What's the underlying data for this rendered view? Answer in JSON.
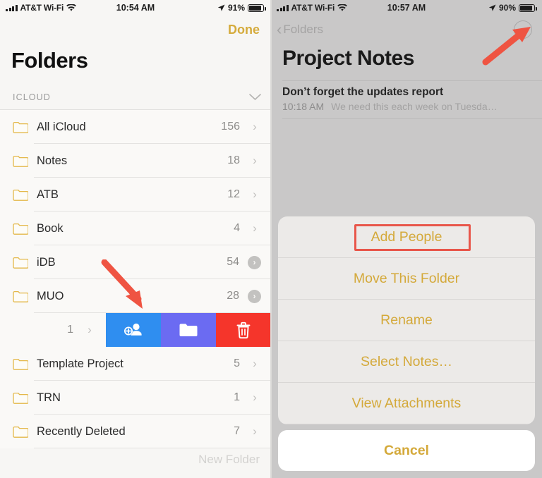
{
  "left_screen": {
    "status_bar": {
      "carrier": "AT&T Wi-Fi",
      "wifi_icon": "wifi-icon",
      "signal_icon": "signal-bars-icon",
      "time": "10:54 AM",
      "location_icon": "location-arrow-icon",
      "battery_percent": "91%",
      "battery_icon": "battery-full-icon"
    },
    "nav": {
      "done_label": "Done"
    },
    "title": "Folders",
    "section": {
      "header": "ICLOUD",
      "collapse_icon": "chevron-down-icon"
    },
    "folders": [
      {
        "name": "All iCloud",
        "count": "156",
        "chevron": "chevron-right-icon",
        "shared": false
      },
      {
        "name": "Notes",
        "count": "18",
        "chevron": "chevron-right-icon",
        "shared": false
      },
      {
        "name": "ATB",
        "count": "12",
        "chevron": "chevron-right-icon",
        "shared": false
      },
      {
        "name": "Book",
        "count": "4",
        "chevron": "chevron-right-icon",
        "shared": false
      },
      {
        "name": "iDB",
        "count": "54",
        "chevron": "chevron-right-circle-icon",
        "shared": true
      },
      {
        "name": "MUO",
        "count": "28",
        "chevron": "chevron-right-circle-icon",
        "shared": true
      }
    ],
    "swiped_row": {
      "count": "1",
      "chevron": "chevron-right-icon",
      "actions": [
        {
          "name": "add-people",
          "icon": "person-add-icon",
          "color": "#2f8ef0"
        },
        {
          "name": "move-folder",
          "icon": "folder-icon",
          "color": "#6b6bf2"
        },
        {
          "name": "delete-folder",
          "icon": "trash-icon",
          "color": "#f5352b"
        }
      ]
    },
    "folders_after": [
      {
        "name": "Template Project",
        "count": "5",
        "chevron": "chevron-right-icon",
        "shared": false
      },
      {
        "name": "TRN",
        "count": "1",
        "chevron": "chevron-right-icon",
        "shared": false
      },
      {
        "name": "Recently Deleted",
        "count": "7",
        "chevron": "chevron-right-icon",
        "shared": false
      }
    ],
    "new_folder_label": "New Folder"
  },
  "right_screen": {
    "status_bar": {
      "carrier": "AT&T Wi-Fi",
      "wifi_icon": "wifi-icon",
      "signal_icon": "signal-bars-icon",
      "time": "10:57 AM",
      "location_icon": "location-arrow-icon",
      "battery_percent": "90%",
      "battery_icon": "battery-full-icon"
    },
    "nav": {
      "back_label": "Folders",
      "back_icon": "chevron-left-icon",
      "more_icon": "ellipsis-circle-icon"
    },
    "title": "Project Notes",
    "note": {
      "title": "Don’t forget the updates report",
      "time": "10:18 AM",
      "preview": "We need this each week on Tuesda…"
    },
    "action_sheet": {
      "items": [
        "Add People",
        "Move This Folder",
        "Rename",
        "Select Notes…",
        "View Attachments"
      ],
      "cancel_label": "Cancel"
    }
  },
  "annotations": {
    "arrow_color": "#ef5442",
    "highlight_color": "#e8564a",
    "left_arrow_target": "add-people-swipe-action",
    "right_arrow_target": "more-options-button",
    "highlight_target": "Add People"
  }
}
